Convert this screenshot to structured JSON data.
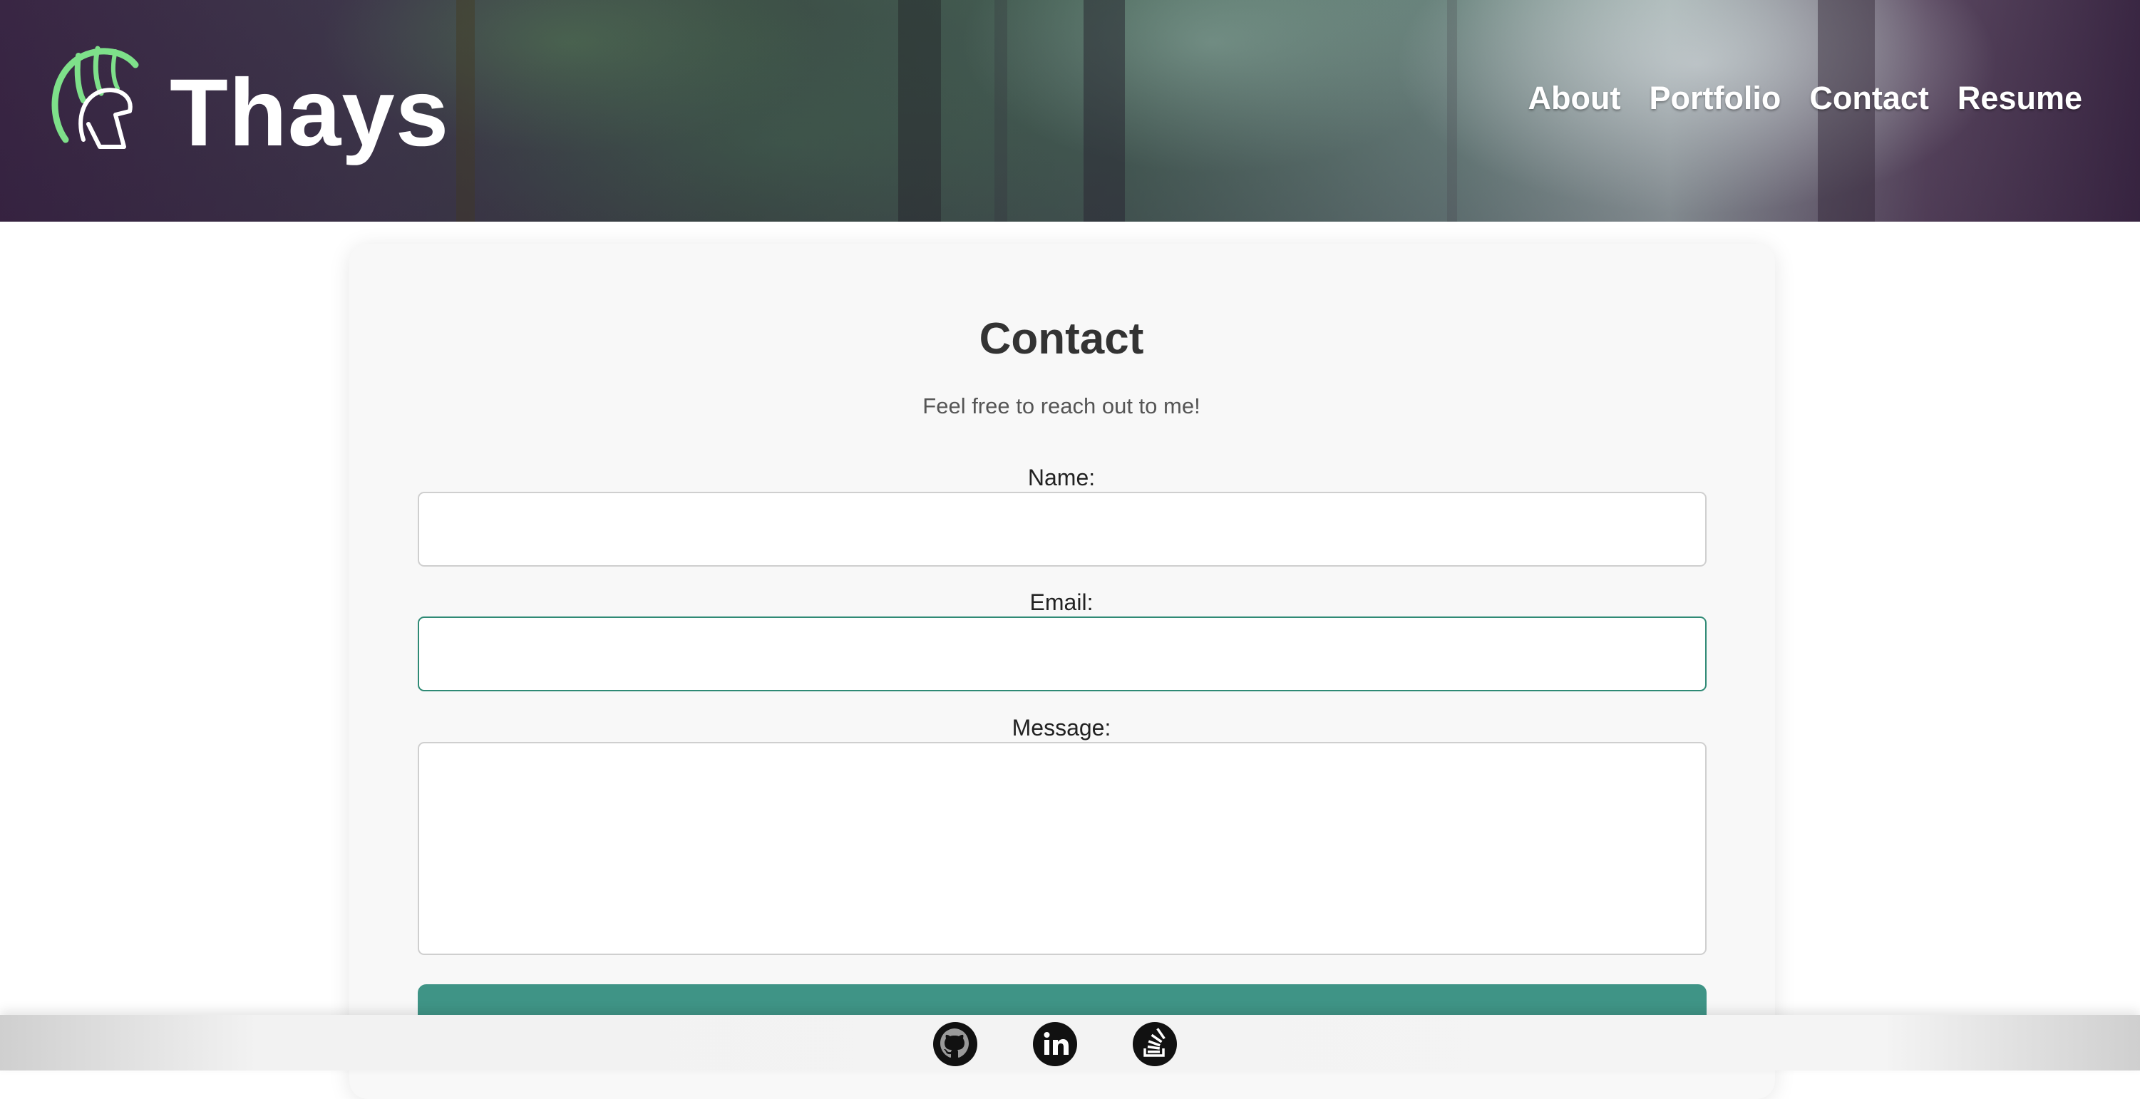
{
  "header": {
    "brand": "Thays",
    "logo_icon": "spartan-helmet-icon",
    "nav": [
      {
        "label": "About"
      },
      {
        "label": "Portfolio"
      },
      {
        "label": "Contact"
      },
      {
        "label": "Resume"
      }
    ]
  },
  "contact": {
    "title": "Contact",
    "subtitle": "Feel free to reach out to me!",
    "name_label": "Name:",
    "name_value": "",
    "email_label": "Email:",
    "email_value": "",
    "message_label": "Message:",
    "message_value": "",
    "send_label": "Send"
  },
  "footer": {
    "links": [
      {
        "icon": "github-icon"
      },
      {
        "icon": "linkedin-icon"
      },
      {
        "icon": "stackoverflow-icon"
      }
    ]
  },
  "colors": {
    "accent": "#3f9486",
    "logo_green": "#7ee08a",
    "focus_border": "#2f8a75",
    "card_bg": "#f8f8f8",
    "header_purple": "#3a2745"
  }
}
